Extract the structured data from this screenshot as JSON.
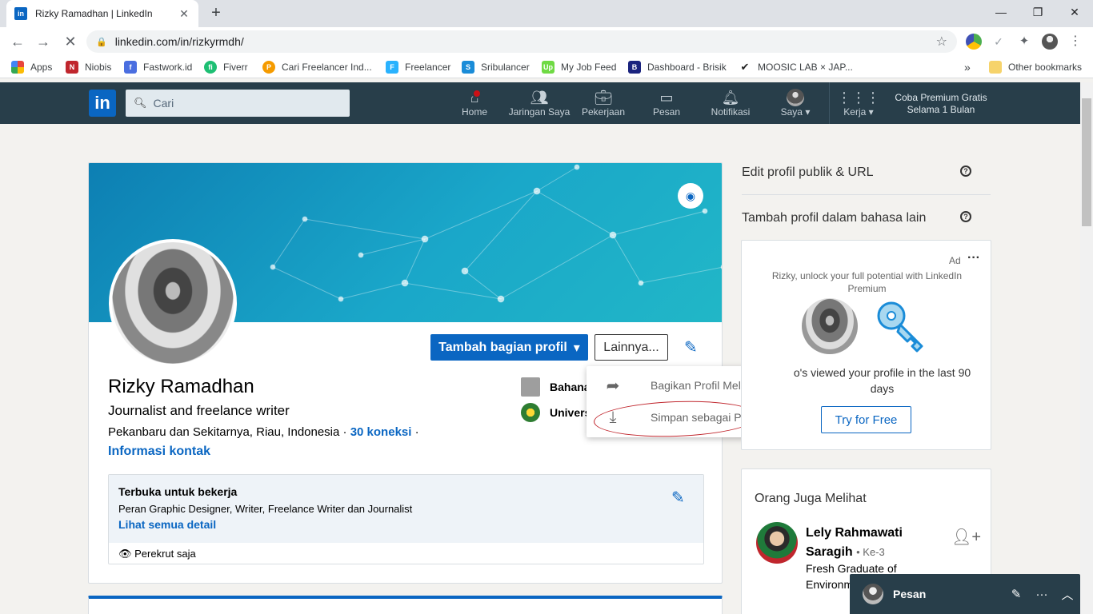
{
  "browser": {
    "tab_title": "Rizky Ramadhan | LinkedIn",
    "url": "linkedin.com/in/rizkyrmdh/",
    "bookmarks": [
      {
        "label": "Apps",
        "icon": "apps-grid-icon",
        "color": "#e8453c"
      },
      {
        "label": "Niobis",
        "icon": "niobis-icon",
        "color": "#c0262d"
      },
      {
        "label": "Fastwork.id",
        "icon": "fastwork-icon",
        "color": "#4a6ee0"
      },
      {
        "label": "Fiverr",
        "icon": "fiverr-icon",
        "color": "#1dbf73"
      },
      {
        "label": "Cari Freelancer Ind...",
        "icon": "projects-icon",
        "color": "#f59b00"
      },
      {
        "label": "Freelancer",
        "icon": "freelancer-icon",
        "color": "#29b2fe"
      },
      {
        "label": "Sribulancer",
        "icon": "sribulancer-icon",
        "color": "#1a8cd8"
      },
      {
        "label": "My Job Feed",
        "icon": "upwork-icon",
        "color": "#6fda44"
      },
      {
        "label": "Dashboard - Brisik",
        "icon": "brisik-icon",
        "color": "#1a237e"
      },
      {
        "label": "MOOSIC LAB × JAP...",
        "icon": "moosic-icon",
        "color": "#222222"
      }
    ],
    "bookmarks_more": "»",
    "other_bookmarks": "Other bookmarks"
  },
  "linkedin_nav": {
    "search_placeholder": "Cari",
    "items": [
      {
        "label": "Home",
        "icon": "home-icon"
      },
      {
        "label": "Jaringan Saya",
        "icon": "network-icon"
      },
      {
        "label": "Pekerjaan",
        "icon": "briefcase-icon"
      },
      {
        "label": "Pesan",
        "icon": "messages-icon"
      },
      {
        "label": "Notifikasi",
        "icon": "bell-icon"
      },
      {
        "label": "Saya",
        "icon": "avatar"
      },
      {
        "label": "Kerja",
        "icon": "apps-grid-icon"
      }
    ],
    "premium_line1": "Coba Premium Gratis",
    "premium_line2": "Selama 1 Bulan"
  },
  "profile": {
    "name": "Rizky Ramadhan",
    "headline": "Journalist and freelance writer",
    "location": "Pekanbaru dan Sekitarnya, Riau, Indonesia",
    "connections": "30 koneksi",
    "contact_info": "Informasi kontak",
    "add_section_button": "Tambah bagian profil",
    "more_button": "Lainnya...",
    "education": [
      {
        "label": "Bahana",
        "color": "#9e9e9e"
      },
      {
        "label": "Univers",
        "color": "#2e7d32"
      }
    ],
    "open_to_work": {
      "title": "Terbuka untuk bekerja",
      "description": "Peran Graphic Designer, Writer, Freelance Writer dan Journalist",
      "link": "Lihat semua detail",
      "visibility": "Perekrut saja"
    }
  },
  "more_menu": {
    "items": [
      {
        "label": "Bagikan Profil Melalui Pesan",
        "icon": "share-arrow-icon"
      },
      {
        "label": "Simpan sebagai PDF",
        "icon": "download-icon"
      }
    ]
  },
  "sidebar": {
    "edit_public_profile": "Edit profil publik & URL",
    "add_language_profile": "Tambah profil dalam bahasa lain",
    "ad": {
      "label": "Ad",
      "text": "Rizky, unlock your full potential with LinkedIn Premium",
      "viewed_text": "o's viewed your profile in the last 90 days",
      "button": "Try for Free"
    },
    "people_also_viewed": {
      "title": "Orang Juga Melihat",
      "person_name": "Lely Rahmawati Saragih",
      "person_degree": "• Ke-3",
      "person_desc": "Fresh Graduate of Environm"
    }
  },
  "messaging": {
    "label": "Pesan"
  },
  "colors": {
    "linkedin_blue": "#0a66c2",
    "nav_bg": "#283e4a",
    "annotation_red": "#c0262d"
  }
}
